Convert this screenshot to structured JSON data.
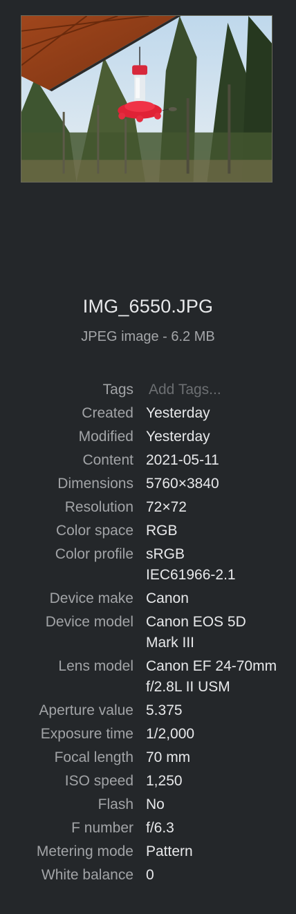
{
  "preview": {
    "alt": "Photo preview: red hummingbird feeder hanging from wooden eave in front of evergreen trees"
  },
  "file": {
    "name": "IMG_6550.JPG",
    "kind": "JPEG image - 6.2 MB"
  },
  "metadata": {
    "tags": {
      "label": "Tags",
      "placeholder": "Add Tags..."
    },
    "created": {
      "label": "Created",
      "value": "Yesterday"
    },
    "modified": {
      "label": "Modified",
      "value": "Yesterday"
    },
    "content": {
      "label": "Content",
      "value": "2021-05-11"
    },
    "dimensions": {
      "label": "Dimensions",
      "value": "5760×3840"
    },
    "resolution": {
      "label": "Resolution",
      "value": "72×72"
    },
    "color_space": {
      "label": "Color space",
      "value": "RGB"
    },
    "color_profile": {
      "label": "Color profile",
      "value": "sRGB IEC61966-2.1"
    },
    "device_make": {
      "label": "Device make",
      "value": "Canon"
    },
    "device_model": {
      "label": "Device model",
      "value": "Canon EOS 5D Mark III"
    },
    "lens_model": {
      "label": "Lens model",
      "value": "Canon EF 24-70mm f/2.8L II USM"
    },
    "aperture": {
      "label": "Aperture value",
      "value": "5.375"
    },
    "exposure": {
      "label": "Exposure time",
      "value": "1/2,000"
    },
    "focal_length": {
      "label": "Focal length",
      "value": "70 mm"
    },
    "iso": {
      "label": "ISO speed",
      "value": "1,250"
    },
    "flash": {
      "label": "Flash",
      "value": "No"
    },
    "f_number": {
      "label": "F number",
      "value": "f/6.3"
    },
    "metering": {
      "label": "Metering mode",
      "value": "Pattern"
    },
    "white_balance": {
      "label": "White balance",
      "value": "0"
    }
  },
  "colors": {
    "background": "#24272a",
    "label": "#a2a4a7",
    "value": "#e8e9eb",
    "placeholder": "#6c6f72"
  }
}
